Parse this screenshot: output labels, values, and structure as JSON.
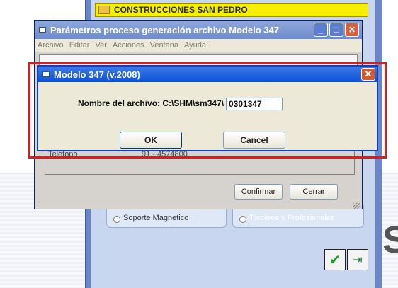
{
  "background_app": {
    "company": "CONSTRUCCIONES SAN PEDRO",
    "radio_left": "Soporte Magnetico",
    "radio_right": "Terceros y Profesionales",
    "big_letter": "S",
    "confirm_icon": "check-icon",
    "exit_icon": "exit-icon"
  },
  "param_window": {
    "title": "Parámetros proceso generación archivo Modelo 347",
    "menu": [
      "Archivo",
      "Editar",
      "Ver",
      "Acciones",
      "Ventana",
      "Ayuda"
    ],
    "partial_row_left": "Teléfono",
    "partial_row_right": "91 - 4574800",
    "confirm_label": "Confirmar",
    "close_label": "Cerrar"
  },
  "modal": {
    "title": "Modelo 347 (v.2008)",
    "field_label": "Nombre del archivo: C:\\SHM\\sm347\\",
    "field_value": "0301347",
    "ok_label": "OK",
    "cancel_label": "Cancel"
  },
  "colors": {
    "highlight_frame": "#d21f1f",
    "modal_title": "#0a52d6",
    "company_bar": "#f6f000"
  }
}
